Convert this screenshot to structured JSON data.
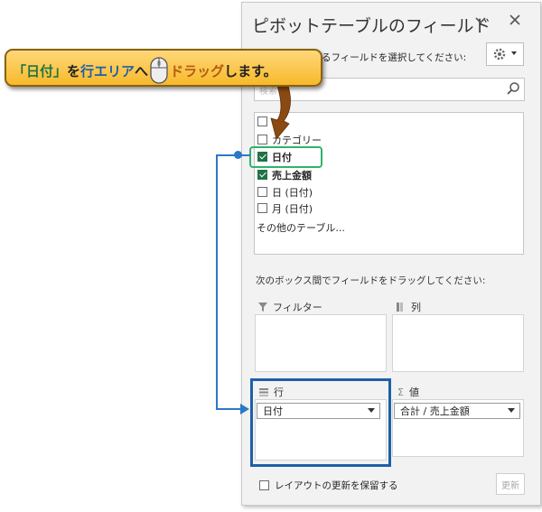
{
  "panel": {
    "title": "ピボットテーブルのフィールド",
    "collapse_icon": "chevron-down-icon",
    "close_icon": "close-icon",
    "choose_fields_label": "るフィールドを選択してください:",
    "gear_icon": "gear-icon",
    "search_placeholder": "検索",
    "search_icon": "magnifier-icon",
    "fields": [
      {
        "label": "",
        "checked": false
      },
      {
        "label": "カテゴリー",
        "checked": false
      },
      {
        "label": "日付",
        "checked": true
      },
      {
        "label": "売上金額",
        "checked": true
      },
      {
        "label": "日 (日付)",
        "checked": false
      },
      {
        "label": "月 (日付)",
        "checked": false
      }
    ],
    "more_tables": "その他のテーブル...",
    "drag_instruction": "次のボックス間でフィールドをドラッグしてください:",
    "areas": {
      "filters": {
        "label": "フィルター",
        "icon": "filter-icon"
      },
      "columns": {
        "label": "列",
        "icon": "columns-icon"
      },
      "rows": {
        "label": "行",
        "icon": "rows-icon",
        "item": "日付"
      },
      "values": {
        "label": "値",
        "icon": "sigma-icon",
        "item": "合計 / 売上金額"
      }
    },
    "defer_label": "レイアウトの更新を保留する",
    "update_button": "更新"
  },
  "callout": {
    "part1": "「日付」",
    "part2": "を",
    "part3": "行エリア",
    "part4": "へ",
    "mouse_icon": "mouse-icon",
    "part5": "ドラッグ",
    "part6": "します。"
  },
  "colors": {
    "callout_fill": "#f7b92a",
    "highlight_green": "#2fb36a",
    "highlight_blue": "#1f5fa8",
    "connector": "#2a79c9",
    "arrow_brown": "#8b4a12",
    "checkbox_green": "#217346"
  }
}
